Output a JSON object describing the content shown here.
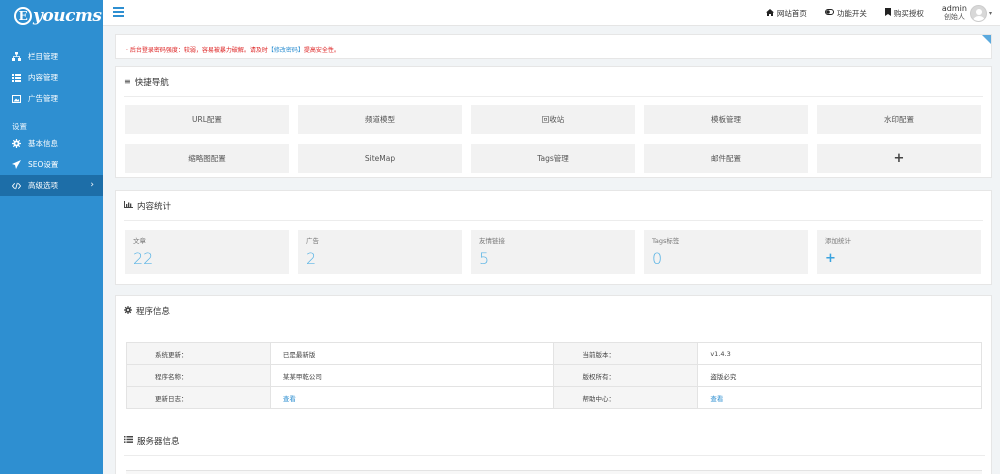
{
  "sidebar": {
    "logo": "youcms",
    "logo_mark": "E",
    "items": [
      {
        "label": "栏目管理",
        "icon": "sitemap-icon"
      },
      {
        "label": "内容管理",
        "icon": "list-icon"
      },
      {
        "label": "广告管理",
        "icon": "image-icon"
      }
    ],
    "group_label": "设置",
    "settings": [
      {
        "label": "基本信息",
        "icon": "gear-icon"
      },
      {
        "label": "SEO设置",
        "icon": "paper-plane-icon"
      },
      {
        "label": "高级选项",
        "icon": "code-icon"
      }
    ]
  },
  "topbar": {
    "home": "网站首页",
    "toggle": "功能开关",
    "buy": "购买授权",
    "username": "admin",
    "role": "创始人"
  },
  "alert": {
    "text_before": "· 后台登录密码强度：较弱，容易被暴力破解。请及时",
    "link": "【修改密码】",
    "text_after": "提高安全性。"
  },
  "quick_nav": {
    "title": "快捷导航",
    "buttons": [
      "URL配置",
      "频道模型",
      "回收站",
      "模板管理",
      "水印配置",
      "缩略图配置",
      "SiteMap",
      "Tags管理",
      "邮件配置",
      "+"
    ]
  },
  "stats": {
    "title": "内容统计",
    "items": [
      {
        "label": "文章",
        "value": "22"
      },
      {
        "label": "广告",
        "value": "2"
      },
      {
        "label": "友情链接",
        "value": "5"
      },
      {
        "label": "Tags标签",
        "value": "0"
      }
    ],
    "add_label": "添加统计",
    "add_symbol": "+"
  },
  "program": {
    "title": "程序信息",
    "rows": [
      {
        "k1": "系统更新：",
        "v1": "已是最新版",
        "k2": "当前版本：",
        "v2": "v1.4.3"
      },
      {
        "k1": "程序名称：",
        "v1": "某某甲乾公司",
        "k2": "版权所有：",
        "v2": "盗版必究"
      },
      {
        "k1": "更新日志：",
        "v1": "查看",
        "k2": "帮助中心：",
        "v2": "查看"
      }
    ]
  },
  "server": {
    "title": "服务器信息"
  },
  "colors": {
    "sidebar": "#2e8fd1",
    "sidebar_active": "#1d6ea8",
    "accent": "#2e8fd1",
    "stat_number": "#5ab4e5",
    "alert": "#dd2222"
  }
}
